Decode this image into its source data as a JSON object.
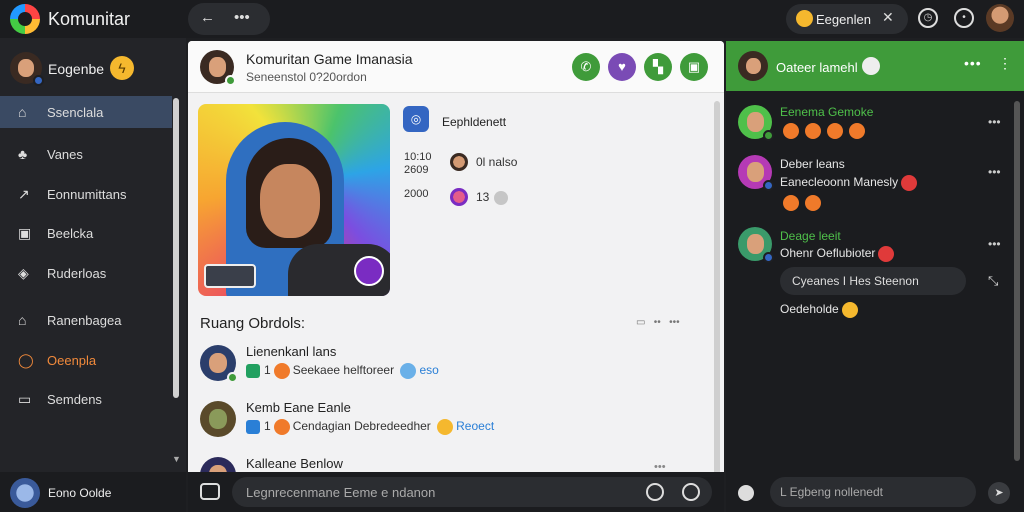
{
  "app": {
    "title": "Komunitar",
    "status_text": "Eegenlen"
  },
  "sidebar": {
    "user_name": "Eogenbe",
    "items": [
      {
        "label": "Ssenclala",
        "icon": "home-icon"
      },
      {
        "label": "Vanes",
        "icon": "games-icon"
      },
      {
        "label": "Eonnumittans",
        "icon": "communities-icon"
      },
      {
        "label": "Beelcka",
        "icon": "library-icon"
      },
      {
        "label": "Ruderloas",
        "icon": "shield-icon"
      },
      {
        "label": "Ranenbagea",
        "icon": "store-icon"
      },
      {
        "label": "Oeenpla",
        "icon": "chat-icon"
      },
      {
        "label": "Semdens",
        "icon": "settings-icon"
      }
    ],
    "bottom_name": "Eono Oolde"
  },
  "main": {
    "title": "Komuritan Game Imanasia",
    "subtitle": "Seneenstol 0?20ordon",
    "info_label": "Eephldenett",
    "stats": [
      {
        "time": "10:10",
        "time2": "2609",
        "text": "0l nalso"
      },
      {
        "time": "2000",
        "time2": "",
        "text": "13"
      }
    ],
    "room_title": "Ruang Obrdols:",
    "rows": [
      {
        "name": "Lienenkanl lans",
        "count": "1",
        "meta": "Seekaee helftoreer",
        "tag": "eso"
      },
      {
        "name": "Kemb Eane Eanle",
        "count": "1",
        "meta": "Cendagian Debredeedher",
        "tag": "Reoect"
      },
      {
        "name": "Kalleane Benlow",
        "count": "",
        "meta": "",
        "tag": ""
      }
    ]
  },
  "composer": {
    "placeholder": "Legnrecenmane Eeme e ndanon"
  },
  "chat": {
    "title": "Oateer lamehl",
    "messages": [
      {
        "name": "Eenema Gemoke",
        "name_color": "#4fc04a",
        "text": ""
      },
      {
        "name": "Deber leans",
        "name_color": "#e6e6e6",
        "text": "Eanecleoonn Manesly"
      },
      {
        "name": "Deage leeit",
        "name_color": "#4fc04a",
        "text": "Ohenr Oeflubioter"
      }
    ],
    "reply_text": "Cyeanes I Hes Steenon",
    "tail_text": "Oedeholde",
    "input_placeholder": "L Egbeng nollenedt"
  }
}
